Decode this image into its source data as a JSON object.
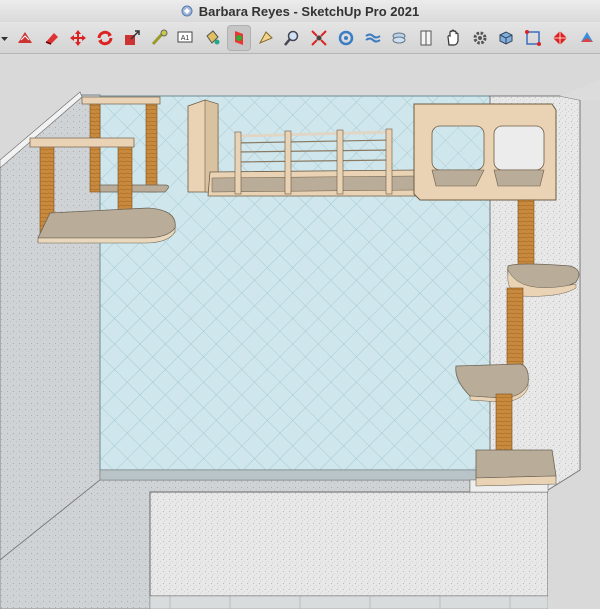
{
  "window": {
    "title": "Barbara Reyes - SketchUp Pro 2021"
  },
  "toolbar": {
    "tools": [
      {
        "icon": "dropdown-arrow-icon"
      },
      {
        "icon": "select-icon"
      },
      {
        "icon": "eraser-icon"
      },
      {
        "icon": "move-icon"
      },
      {
        "icon": "rotate-icon"
      },
      {
        "icon": "scale-icon"
      },
      {
        "icon": "tape-measure-icon"
      },
      {
        "icon": "text-icon"
      },
      {
        "icon": "paint-bucket-icon"
      },
      {
        "icon": "section-plane-icon"
      },
      {
        "icon": "follow-me-icon"
      },
      {
        "icon": "zoom-icon"
      },
      {
        "icon": "zoom-extents-icon"
      },
      {
        "icon": "orbit-icon"
      },
      {
        "icon": "sandbox-icon"
      },
      {
        "icon": "layers-icon"
      },
      {
        "icon": "door-icon"
      },
      {
        "icon": "pan-icon"
      },
      {
        "icon": "settings-gear-icon"
      },
      {
        "icon": "components-icon"
      },
      {
        "icon": "extension-icon"
      },
      {
        "icon": "ruby-icon"
      },
      {
        "icon": "styles-icon"
      }
    ],
    "active_tool": "section-plane-icon"
  },
  "colors": {
    "wall_back": "#cfe7ec",
    "wall_side": "#e6e6e6",
    "wood_light": "#e9d3b4",
    "sisal": "#c98a3e",
    "platform": "#b9ad9a"
  }
}
